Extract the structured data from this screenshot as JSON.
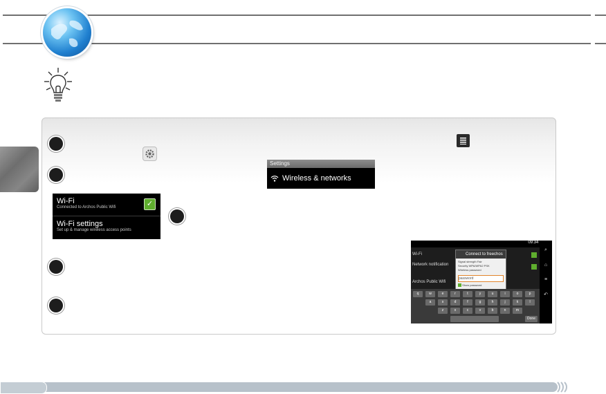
{
  "header": {
    "icon": "globe-icon"
  },
  "tip": {
    "icon": "lightbulb-icon"
  },
  "steps": [
    {
      "icon": "step-bullet"
    },
    {
      "icon": "step-bullet"
    },
    {
      "icon": "step-bullet"
    },
    {
      "icon": "step-bullet"
    },
    {
      "icon": "step-bullet"
    }
  ],
  "inline_icons": {
    "settings": "settings-gear-icon",
    "menu": "menu-icon"
  },
  "settings_screen": {
    "header": "Settings",
    "item": "Wireless & networks"
  },
  "wifi_screen": {
    "wifi_title": "Wi-Fi",
    "wifi_status": "Connected to Archos Public Wifi",
    "wifi_checked": true,
    "settings_title": "Wi-Fi settings",
    "settings_subtitle": "Set up & manage wireless access points"
  },
  "tablet": {
    "clock": "09:34",
    "list": [
      {
        "title": "Wi-Fi",
        "checked": true
      },
      {
        "title": "Network notification",
        "checked": true
      },
      {
        "title": "Archos Public Wifi",
        "checked": false
      }
    ],
    "dialog": {
      "title": "Connect to freechos",
      "signal_label": "Signal strength",
      "signal_value": "Fair",
      "security_label": "Security",
      "security_value": "WPA/WPA2 PSK",
      "password_label": "Wireless password",
      "password_placeholder": "password",
      "show_password": "Show password"
    },
    "keyboard": {
      "row1": [
        "q",
        "w",
        "e",
        "r",
        "t",
        "y",
        "u",
        "i",
        "o",
        "p"
      ],
      "row2": [
        "a",
        "s",
        "d",
        "f",
        "g",
        "h",
        "j",
        "k",
        "l"
      ],
      "row3": [
        "z",
        "x",
        "c",
        "v",
        "b",
        "n",
        "m"
      ],
      "done": "Done"
    }
  }
}
